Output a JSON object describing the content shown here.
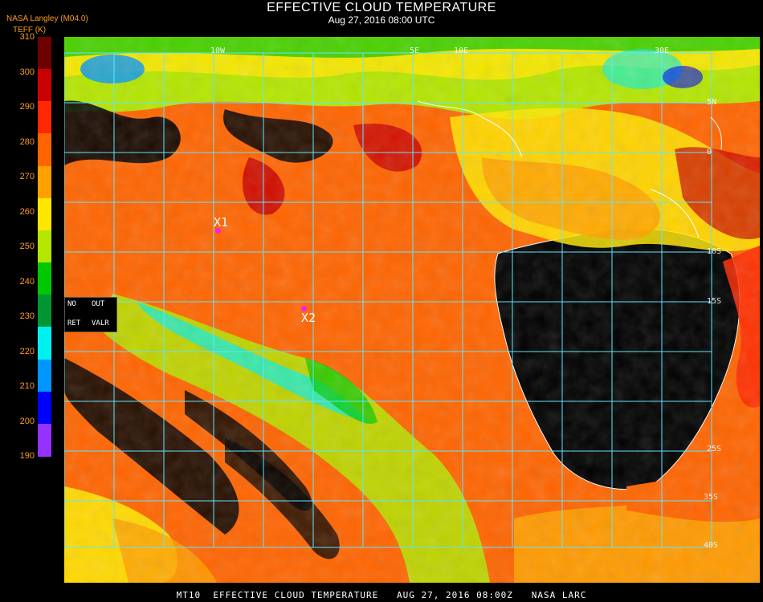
{
  "header": {
    "title": "EFFECTIVE CLOUD TEMPERATURE",
    "datetime": "Aug 27, 2016 08:00 UTC"
  },
  "legend": {
    "org": "NASA Langley (M04.0)",
    "unit": "TEFF (K)",
    "ticks": [
      "310",
      "300",
      "290",
      "280",
      "270",
      "260",
      "250",
      "240",
      "230",
      "220",
      "210",
      "200",
      "190"
    ],
    "colors": [
      "#6e0000",
      "#c80000",
      "#ff2800",
      "#ff6400",
      "#ffa000",
      "#ffe600",
      "#b4e600",
      "#00c800",
      "#009632",
      "#00f0f0",
      "#0096ff",
      "#0000ff",
      "#9632ff"
    ]
  },
  "status_box": {
    "no": "NO",
    "out": "OUT",
    "ret": "RET",
    "valr": "VALR"
  },
  "grid_labels": {
    "lon_top": [
      "5E",
      "10E",
      "30E"
    ],
    "lat_right": [
      "5N",
      "0",
      "10S",
      "15S",
      "25S",
      "35S",
      "40S"
    ],
    "other": [
      "10W"
    ]
  },
  "markers": [
    {
      "label": "X1"
    },
    {
      "label": "X2"
    }
  ],
  "footer": "MT10  EFFECTIVE CLOUD TEMPERATURE   AUG 27, 2016 08:00Z   NASA LARC",
  "colors": {
    "ocean_low_cloud": "#ff6400",
    "land_clear": "#000000",
    "grid": "#5fe6ff",
    "coast": "#ffffff",
    "marker": "#ff1ee6"
  }
}
